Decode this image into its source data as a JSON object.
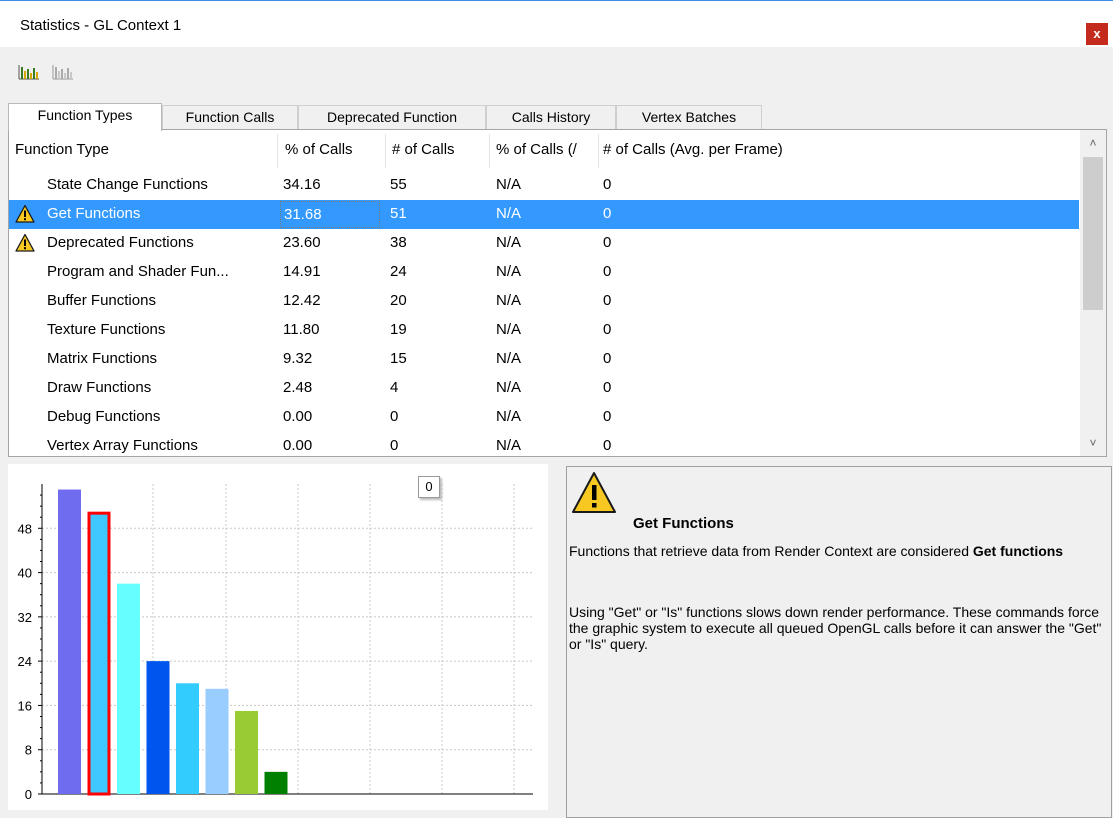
{
  "window": {
    "title": "Statistics - GL Context 1",
    "close_label": "x"
  },
  "toolbar": {
    "icons": [
      "bar-chart-color-icon",
      "bar-chart-gray-icon"
    ]
  },
  "tabs": [
    {
      "label": "Function Types",
      "active": true
    },
    {
      "label": "Function Calls",
      "active": false
    },
    {
      "label": "Deprecated Function",
      "active": false
    },
    {
      "label": "Calls History",
      "active": false
    },
    {
      "label": "Vertex Batches",
      "active": false
    }
  ],
  "table": {
    "columns": [
      "Function Type",
      "% of Calls",
      "# of Calls",
      "% of Calls (Avg. per Frame)",
      "# of Calls (Avg. per Frame)"
    ],
    "column_display": [
      "Function Type",
      "% of Calls",
      "# of Calls",
      "% of Calls (/",
      "# of Calls (Avg. per Frame)"
    ],
    "rows": [
      {
        "name": "State Change Functions",
        "pct": "34.16",
        "count": "55",
        "pct_avg": "N/A",
        "count_avg": "0",
        "warning": false,
        "selected": false
      },
      {
        "name": "Get Functions",
        "pct": "31.68",
        "count": "51",
        "pct_avg": "N/A",
        "count_avg": "0",
        "warning": true,
        "selected": true
      },
      {
        "name": "Deprecated Functions",
        "pct": "23.60",
        "count": "38",
        "pct_avg": "N/A",
        "count_avg": "0",
        "warning": true,
        "selected": false
      },
      {
        "name": "Program and Shader Fun...",
        "pct": "14.91",
        "count": "24",
        "pct_avg": "N/A",
        "count_avg": "0",
        "warning": false,
        "selected": false
      },
      {
        "name": "Buffer Functions",
        "pct": "12.42",
        "count": "20",
        "pct_avg": "N/A",
        "count_avg": "0",
        "warning": false,
        "selected": false
      },
      {
        "name": "Texture Functions",
        "pct": "11.80",
        "count": "19",
        "pct_avg": "N/A",
        "count_avg": "0",
        "warning": false,
        "selected": false
      },
      {
        "name": "Matrix Functions",
        "pct": "9.32",
        "count": "15",
        "pct_avg": "N/A",
        "count_avg": "0",
        "warning": false,
        "selected": false
      },
      {
        "name": "Draw Functions",
        "pct": "2.48",
        "count": "4",
        "pct_avg": "N/A",
        "count_avg": "0",
        "warning": false,
        "selected": false
      },
      {
        "name": "Debug Functions",
        "pct": "0.00",
        "count": "0",
        "pct_avg": "N/A",
        "count_avg": "0",
        "warning": false,
        "selected": false
      },
      {
        "name": "Vertex Array Functions",
        "pct": "0.00",
        "count": "0",
        "pct_avg": "N/A",
        "count_avg": "0",
        "warning": false,
        "selected": false
      }
    ]
  },
  "chart": {
    "badge": "0",
    "colors": [
      "#6f6cf0",
      "#3fc8ff",
      "#66ffff",
      "#0055ee",
      "#33ccff",
      "#99ccff",
      "#99cc33",
      "#008000"
    ],
    "selected_index": 1,
    "selected_outline": "#ff0000"
  },
  "chart_data": {
    "type": "bar",
    "categories": [
      "State Change Functions",
      "Get Functions",
      "Deprecated Functions",
      "Program and Shader Functions",
      "Buffer Functions",
      "Texture Functions",
      "Matrix Functions",
      "Draw Functions"
    ],
    "values": [
      55,
      51,
      38,
      24,
      20,
      19,
      15,
      4
    ],
    "yticks": [
      "0",
      "8",
      "16",
      "24",
      "32",
      "40",
      "48"
    ],
    "ylim": [
      0,
      56
    ],
    "grid": true,
    "title": "",
    "xlabel": "",
    "ylabel": ""
  },
  "info": {
    "title": "Get Functions",
    "p1_text": "Functions that retrieve data from Render Context are considered ",
    "p1_bold": "Get functions",
    "p2": "Using \"Get\" or \"Is\" functions slows down render performance. These commands force the graphic system to execute all queued OpenGL calls before it can answer the \"Get\" or \"Is\" query.",
    "icon": "warning-icon"
  }
}
